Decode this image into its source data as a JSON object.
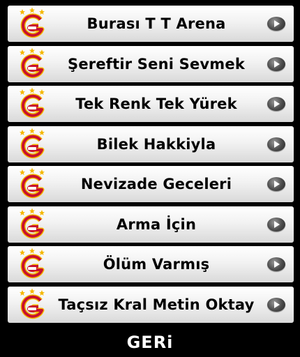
{
  "items": [
    {
      "label": "Burası T T Arena",
      "icon": "galatasaray-logo-icon",
      "action_icon": "play-icon"
    },
    {
      "label": "Şereftir Seni Sevmek",
      "icon": "galatasaray-logo-icon",
      "action_icon": "play-icon"
    },
    {
      "label": "Tek Renk Tek Yürek",
      "icon": "galatasaray-logo-icon",
      "action_icon": "play-icon"
    },
    {
      "label": "Bilek Hakkiyla",
      "icon": "galatasaray-logo-icon",
      "action_icon": "play-icon"
    },
    {
      "label": "Nevizade Geceleri",
      "icon": "galatasaray-logo-icon",
      "action_icon": "play-icon"
    },
    {
      "label": "Arma İçin",
      "icon": "galatasaray-logo-icon",
      "action_icon": "play-icon"
    },
    {
      "label": "Ölüm Varmış",
      "icon": "galatasaray-logo-icon",
      "action_icon": "play-icon"
    },
    {
      "label": "Taçsız Kral Metin Oktay",
      "icon": "galatasaray-logo-icon",
      "action_icon": "play-icon"
    }
  ],
  "back_label": "GERi",
  "colors": {
    "background": "#000000",
    "logo_red": "#c8102e",
    "logo_yellow": "#f5b800",
    "star": "#f5b800"
  }
}
